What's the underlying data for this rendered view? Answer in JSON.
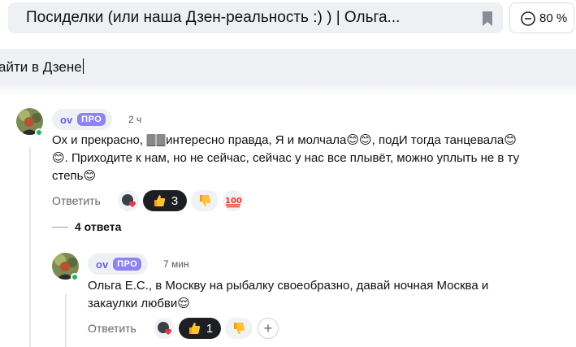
{
  "browser": {
    "tab_title": "Посиделки (или наша Дзен-реальность :) ) | Ольга...",
    "zoom": "80 %",
    "bookmark_icon": "bookmark-icon",
    "zoom_icon": "zoom-icon"
  },
  "search": {
    "value": "айти в Дзене"
  },
  "comments": [
    {
      "author": "ov",
      "badge": "ПРО",
      "time": "2 ч",
      "text_lines": [
        "Ох и прекрасно, 🀫🀫интересно правда, Я и молчала😊😊, подИ тогда танцевала😊",
        "😊. Приходите к нам, но не сейчас, сейчас у нас все плывёт, можно уплыть не в ту",
        "степь😊"
      ],
      "reply_label": "Ответить",
      "likes": "3",
      "reaction_icons": [
        "heart-reaction-icon",
        "thumbs-up-icon",
        "thumbs-down-icon",
        "hundred-icon"
      ]
    },
    {
      "author": "ov",
      "badge": "ПРО",
      "time": "7 мин",
      "text_lines": [
        "Ольга Е.С., в Москву на рыбалку своеобразно, давай ночная Москва и",
        "закаулки любви😌"
      ],
      "reply_label": "Ответить",
      "likes": "1",
      "add_label": "+",
      "reaction_icons": [
        "heart-reaction-icon",
        "thumbs-up-icon",
        "thumbs-down-icon",
        "add-reaction-icon"
      ]
    }
  ],
  "thread": {
    "answers_label": "4 ответа"
  },
  "colors": {
    "accent": "#6a5de0",
    "pro_badge": "#8f84ef",
    "online": "#1db954",
    "dark_reaction": "#1e1f22"
  }
}
